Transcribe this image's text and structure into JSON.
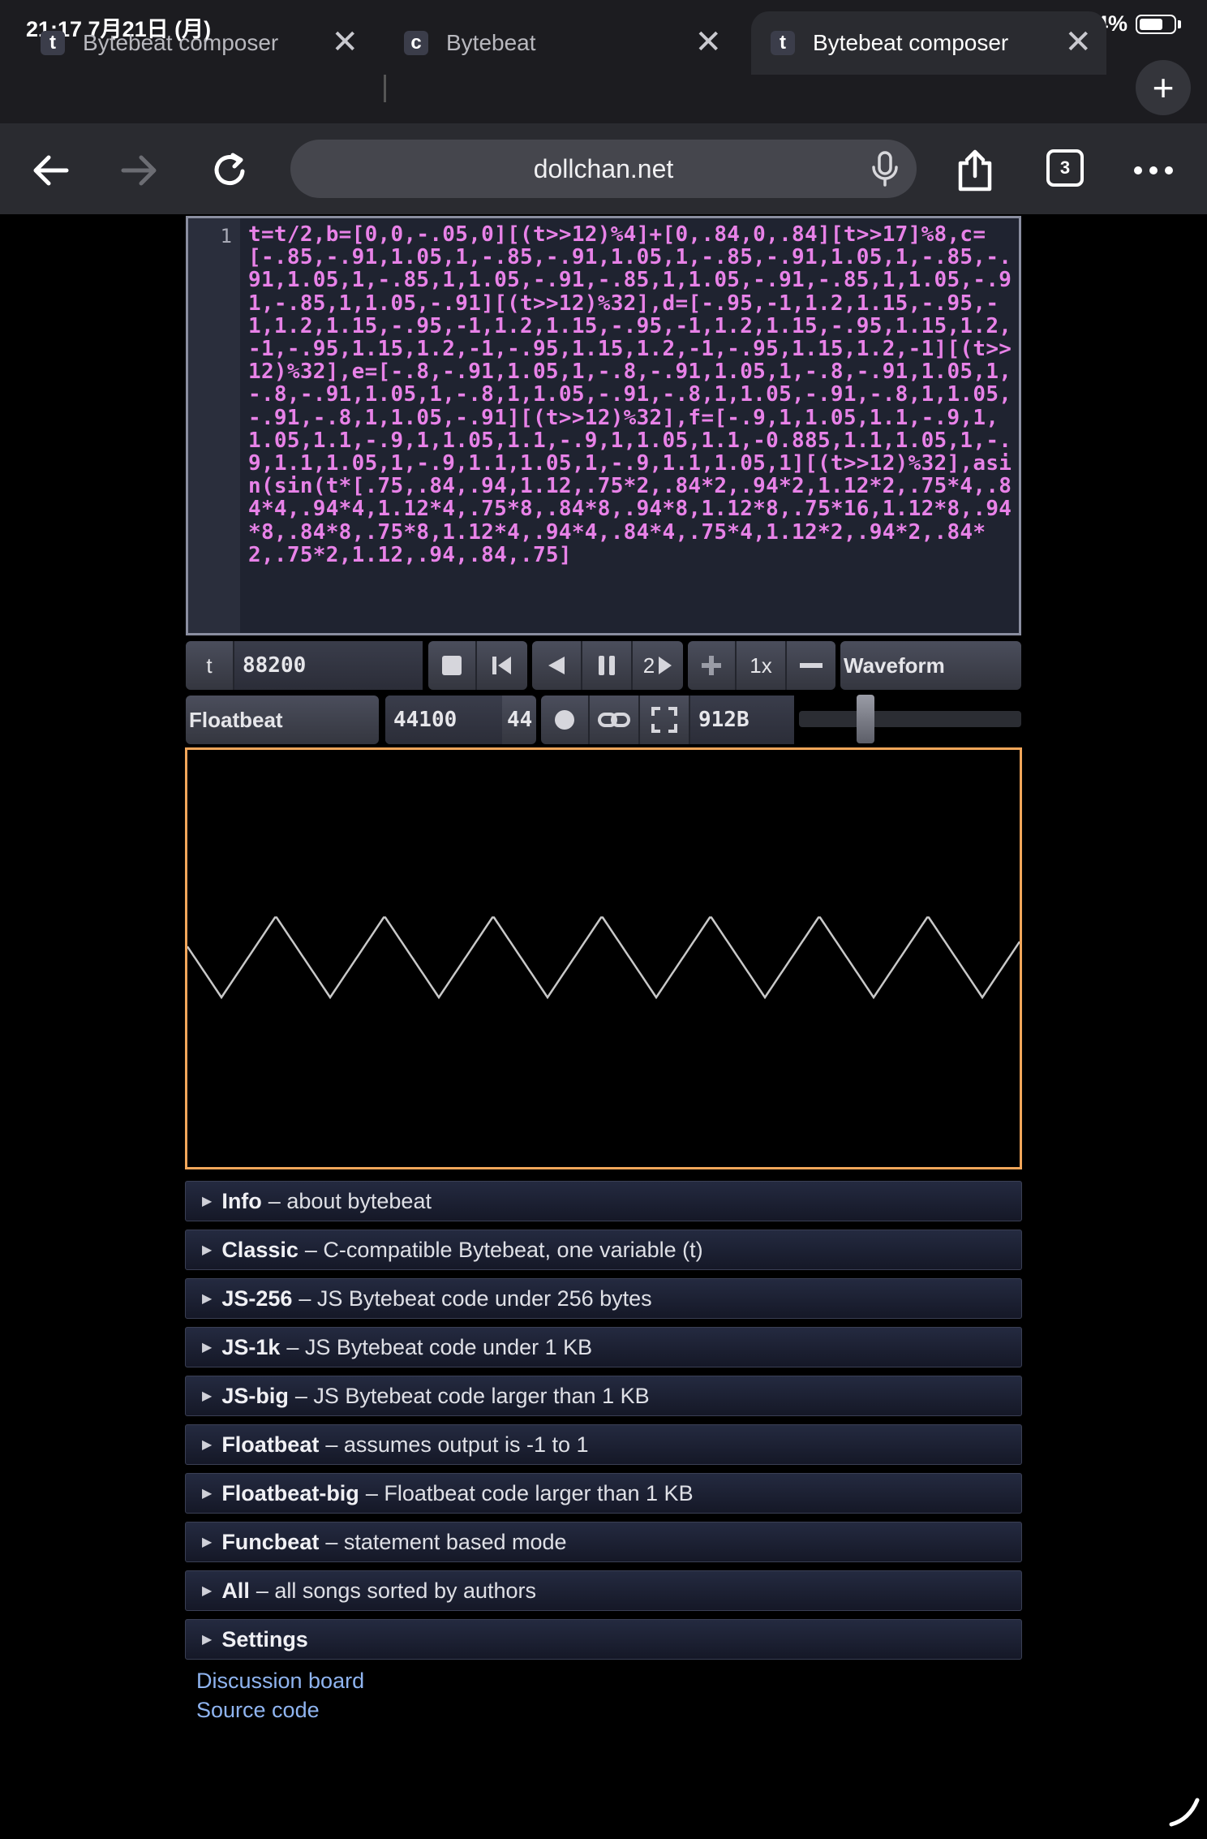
{
  "status": {
    "time": "21:17  7月21日 (月)",
    "battery": "64%"
  },
  "tabs": [
    {
      "favicon": "t",
      "title": "Bytebeat composer"
    },
    {
      "favicon": "c",
      "title": "Bytebeat"
    },
    {
      "favicon": "t",
      "title": "Bytebeat composer",
      "active": true
    }
  ],
  "toolbar": {
    "url": "dollchan.net",
    "tab_count": "3"
  },
  "editor": {
    "line_number": "1",
    "code": "t=t/2,b=[0,0,-.05,0][(t>>12)%4]+[0,.84,0,.84][t>>17]%8,c=[-.85,-.91,1.05,1,-.85,-.91,1.05,1,-.85,-.91,1.05,1,-.85,-.91,1.05,1,-.85,1,1.05,-.91,-.85,1,1.05,-.91,-.85,1,1.05,-.91,-.85,1,1.05,-.91][(t>>12)%32],d=[-.95,-1,1.2,1.15,-.95,-1,1.2,1.15,-.95,-1,1.2,1.15,-.95,-1,1.2,1.15,-.95,1.15,1.2,-1,-.95,1.15,1.2,-1,-.95,1.15,1.2,-1,-.95,1.15,1.2,-1][(t>>12)%32],e=[-.8,-.91,1.05,1,-.8,-.91,1.05,1,-.8,-.91,1.05,1,-.8,-.91,1.05,1,-.8,1,1.05,-.91,-.8,1,1.05,-.91,-.8,1,1.05,-.91,-.8,1,1.05,-.91][(t>>12)%32],f=[-.9,1,1.05,1.1,-.9,1,1.05,1.1,-.9,1,1.05,1.1,-.9,1,1.05,1.1,-0.885,1.1,1.05,1,-.9,1.1,1.05,1,-.9,1.1,1.05,1,-.9,1.1,1.05,1][(t>>12)%32],asin(sin(t*[.75,.84,.94,1.12,.75*2,.84*2,.94*2,1.12*2,.75*4,.84*4,.94*4,1.12*4,.75*8,.84*8,.94*8,1.12*8,.75*16,1.12*8,.94*8,.84*8,.75*8,1.12*4,.94*4,.84*4,.75*4,1.12*2,.94*2,.84*2,.75*2,1.12,.94,.84,.75]"
  },
  "controls": {
    "t_label": "t",
    "t_value": "88200",
    "speed_step": "2",
    "speed": "1x",
    "mode": "Waveform",
    "type": "Floatbeat",
    "sample_rate": "44100",
    "sample_rate_preset": "44",
    "size": "912B",
    "volume": 0.28
  },
  "sections": [
    {
      "name": "Info",
      "desc": "– about bytebeat"
    },
    {
      "name": "Classic",
      "desc": "– C-compatible Bytebeat, one variable (t)"
    },
    {
      "name": "JS-256",
      "desc": "– JS Bytebeat code under 256 bytes"
    },
    {
      "name": "JS-1k",
      "desc": "– JS Bytebeat code under 1 KB"
    },
    {
      "name": "JS-big",
      "desc": "– JS Bytebeat code larger than 1 KB"
    },
    {
      "name": "Floatbeat",
      "desc": "– assumes output is -1 to 1"
    },
    {
      "name": "Floatbeat-big",
      "desc": "– Floatbeat code larger than 1 KB"
    },
    {
      "name": "Funcbeat",
      "desc": "– statement based mode"
    },
    {
      "name": "All",
      "desc": "– all songs sorted by authors"
    },
    {
      "name": "Settings",
      "desc": ""
    }
  ],
  "links": {
    "discussion": "Discussion board",
    "source": "Source code"
  },
  "colors": {
    "accent_border": "#f2a65a",
    "code": "#e882e8",
    "link": "#8fb4f0"
  }
}
